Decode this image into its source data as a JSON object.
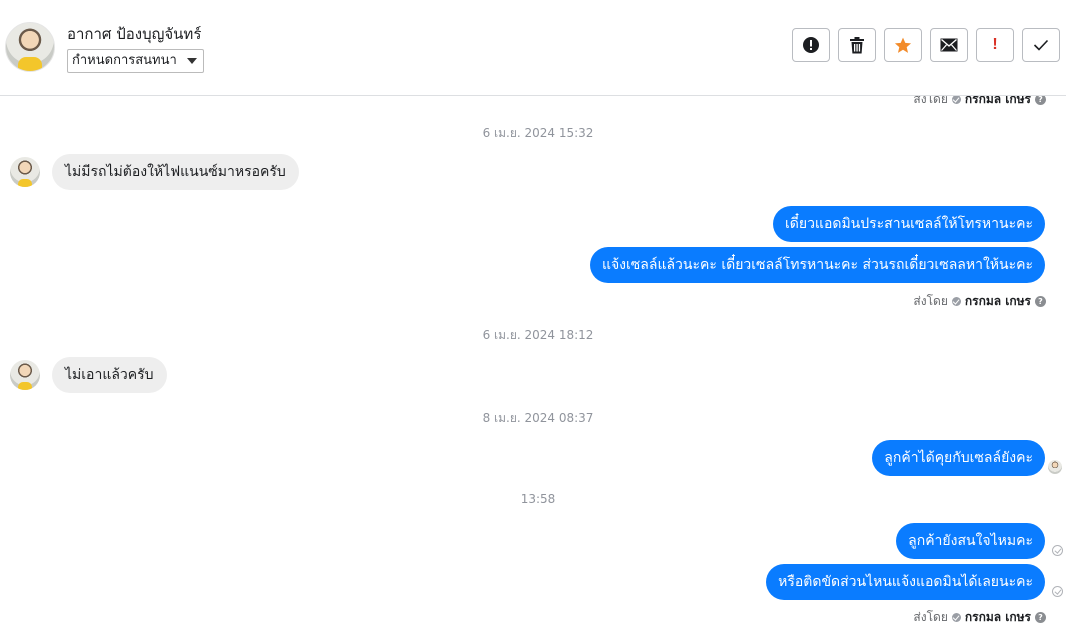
{
  "header": {
    "contact_name": "อากาศ ป้องบุญจันทร์",
    "status_select": "กำหนดการสนทนา",
    "toolbar": {
      "spam": "alert-circle-icon",
      "delete": "trash-icon",
      "star": "star-icon",
      "mail": "envelope-icon",
      "important": "!",
      "done": "check-icon"
    },
    "colors": {
      "star": "#f28b2a",
      "important": "#d93025"
    }
  },
  "chat": {
    "sent_by_label": "ส่งโดย",
    "sent_by_name": "กรกมล เกษร",
    "help": "?",
    "timestamps": [
      "6 เม.ย. 2024 15:32",
      "6 เม.ย. 2024 18:12",
      "8 เม.ย. 2024 08:37",
      "13:58"
    ],
    "messages": [
      {
        "dir": "in",
        "text": "ไม่มีรถไม่ต้องให้ไฟแนนซ์มาหรอครับ"
      },
      {
        "dir": "out",
        "text": "เดี๋ยวแอดมินประสานเซลล์ให้โทรหานะคะ"
      },
      {
        "dir": "out",
        "text": "แจ้งเซลล์แล้วนะคะ เดี๋ยวเซลล์โทรหานะคะ ส่วนรถเดี๋ยวเซลลหาให้นะคะ"
      },
      {
        "dir": "in",
        "text": "ไม่เอาแล้วครับ"
      },
      {
        "dir": "out",
        "text": "ลูกค้าได้คุยกับเซลล์ยังคะ"
      },
      {
        "dir": "out",
        "text": "ลูกค้ายังสนใจไหมคะ"
      },
      {
        "dir": "out",
        "text": "หรือติดขัดส่วนไหนแจ้งแอดมินได้เลยนะคะ"
      }
    ],
    "colors": {
      "outgoing_bubble": "#0a7cff",
      "incoming_bubble": "#eeeeee"
    }
  }
}
